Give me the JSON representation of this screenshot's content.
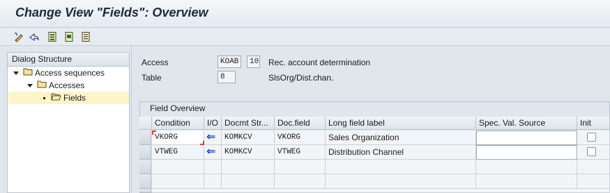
{
  "window": {
    "title": "Change View \"Fields\": Overview"
  },
  "toolbar": {
    "buttons": [
      {
        "name": "display-change-icon"
      },
      {
        "name": "undo-icon"
      },
      {
        "name": "select-all-icon"
      },
      {
        "name": "select-block-icon"
      },
      {
        "name": "deselect-all-icon"
      }
    ]
  },
  "dialog_structure": {
    "header": "Dialog Structure",
    "items": [
      {
        "label": "Access sequences",
        "level": 0,
        "expanded": true,
        "selected": false
      },
      {
        "label": "Accesses",
        "level": 1,
        "expanded": true,
        "selected": false
      },
      {
        "label": "Fields",
        "level": 2,
        "expanded": false,
        "selected": true
      }
    ]
  },
  "header_fields": {
    "access_label": "Access",
    "access_value": "KOAB",
    "access_number": "10",
    "access_desc": "Rec. account determination",
    "table_label": "Table",
    "table_value": "8",
    "table_desc": "SlsOrg/Dist.chan."
  },
  "field_overview": {
    "title": "Field Overview",
    "columns": [
      "Condition",
      "I/O",
      "Docmt Str...",
      "Doc.field",
      "Long field label",
      "Spec. Val. Source",
      "Init"
    ],
    "rows": [
      {
        "condition": "VKORG",
        "io": "⇐",
        "docmt_str": "KOMKCV",
        "doc_field": "VKORG",
        "long_label": "Sales Organization",
        "spec_val": "",
        "init": false
      },
      {
        "condition": "VTWEG",
        "io": "⇐",
        "docmt_str": "KOMKCV",
        "doc_field": "VTWEG",
        "long_label": "Distribution Channel",
        "spec_val": "",
        "init": false
      }
    ]
  },
  "colors": {
    "io_arrow": "#1f3fb8",
    "selection": "#fdf5c9",
    "focus": "#e23b2a"
  }
}
